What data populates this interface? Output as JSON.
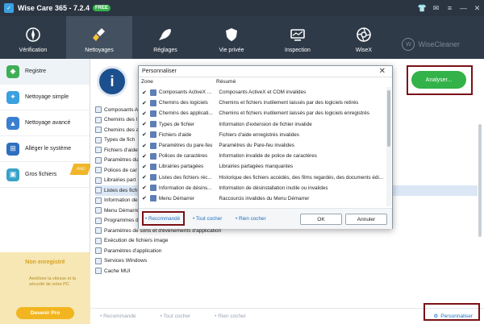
{
  "titlebar": {
    "app_title": "Wise Care 365 - 7.2.4",
    "badge": "FREE"
  },
  "nav": {
    "items": [
      {
        "label": "Vérification",
        "icon": "compass-icon"
      },
      {
        "label": "Nettoyages",
        "icon": "broom-icon"
      },
      {
        "label": "Réglages",
        "icon": "rocket-icon"
      },
      {
        "label": "Vie privée",
        "icon": "shield-icon"
      },
      {
        "label": "Inspection",
        "icon": "monitor-icon"
      },
      {
        "label": "WiseX",
        "icon": "aperture-icon"
      }
    ],
    "brand": "WiseCleaner",
    "brand_mark": "W"
  },
  "sidebar": {
    "items": [
      {
        "label": "Registre"
      },
      {
        "label": "Nettoyage simple"
      },
      {
        "label": "Nettoyage avancé"
      },
      {
        "label": "Alléger le système"
      },
      {
        "label": "Gros fichiers",
        "ribbon": "PRO"
      }
    ],
    "promo": {
      "title": "Non enregistré",
      "desc": "Améliore la vitesse et la sécurité de votre PC",
      "button": "Devenir Pro"
    }
  },
  "main": {
    "info_glyph": "i",
    "analyze_button": "Analyser...",
    "list": [
      "Composants A",
      "Chemins des l",
      "Chemins des a",
      "Types de fich",
      "Fichiers d'aide",
      "Paramètres du",
      "Polices de car",
      "Librairies part",
      "Listes des fich",
      "Information de",
      "Menu Démarrer",
      "Programmes de démarrage",
      "Paramètres de sons et d'évènements d'application",
      "Exécution de fichiers image",
      "Paramètres d'application",
      "Services Windows",
      "Cache MUI"
    ],
    "bottom": {
      "recommended": "• Recommandé",
      "check_all": "• Tout cocher",
      "uncheck_all": "• Rien cocher",
      "customize": "Personnaliser"
    }
  },
  "dialog": {
    "title": "Personnaliser",
    "col_zone": "Zone",
    "col_summary": "Résumé",
    "rows": [
      {
        "name": "Composants ActiveX ...",
        "desc": "Composants ActiveX et COM invalides"
      },
      {
        "name": "Chemins des logiciels",
        "desc": "Chemins et fichiers inutilement laissés par des logiciels retirés"
      },
      {
        "name": "Chemins des applicati...",
        "desc": "Chemins et fichiers inutilement laissés par des logiciels enregistrés"
      },
      {
        "name": "Types de fichier",
        "desc": "Information d'extension de fichier invalide"
      },
      {
        "name": "Fichiers d'aide",
        "desc": "Fichiers d'aide enregistrés invalides"
      },
      {
        "name": "Paramètres du pare-feu",
        "desc": "Paramètres du Pare-feu invalides"
      },
      {
        "name": "Polices de caractères",
        "desc": "Information invalide de police de caractères"
      },
      {
        "name": "Librairies partagées",
        "desc": "Librairies partagées manquantes"
      },
      {
        "name": "Listes des fichiers réc...",
        "desc": "Historique des fichiers accédés, des films regardés, des documents édi..."
      },
      {
        "name": "Information de désins...",
        "desc": "Information de désinstallation inutile ou invalides"
      },
      {
        "name": "Menu Démarrer",
        "desc": "Raccourcis invalides du Menu Démarrer"
      }
    ],
    "recommended": "• Recommandé",
    "check_all": "• Tout cocher",
    "uncheck_all": "• Rien cocher",
    "ok": "OK",
    "cancel": "Annuler"
  }
}
